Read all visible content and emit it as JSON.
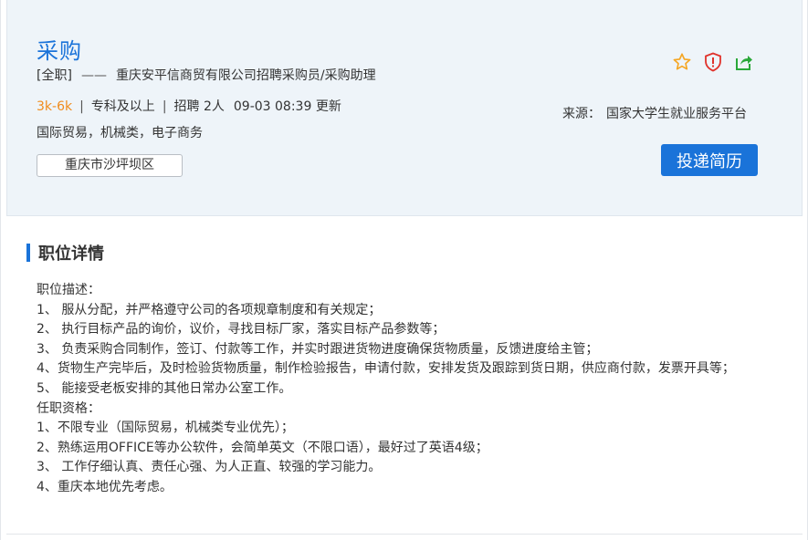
{
  "job": {
    "title": "采购",
    "type": "[全职]",
    "dash": "——",
    "company_line": "重庆安平信商贸有限公司招聘采购员/采购助理",
    "salary": "3k-6k",
    "sep": "|",
    "education": "专科及以上",
    "hiring": "招聘 2人",
    "updated": "09-03 08:39 更新",
    "tags": "国际贸易，机械类，电子商务",
    "location": "重庆市沙坪坝区",
    "source_label": "来源：",
    "source_value": "国家大学生就业服务平台",
    "apply_label": "投递简历",
    "icons": [
      "star-icon",
      "report-shield-icon",
      "share-icon"
    ]
  },
  "detail": {
    "heading": "职位详情",
    "lines": [
      "职位描述：",
      "1、 服从分配，并严格遵守公司的各项规章制度和有关规定；",
      "2、 执行目标产品的询价，议价，寻找目标厂家，落实目标产品参数等；",
      "3、 负责采购合同制作，签订、付款等工作，并实时跟进货物进度确保货物质量，反馈进度给主管；",
      "4、货物生产完毕后，及时检验货物质量，制作检验报告，申请付款，安排发货及跟踪到货日期，供应商付款，发票开具等；",
      "5、 能接受老板安排的其他日常办公室工作。",
      "任职资格：",
      "1、不限专业（国际贸易，机械类专业优先）；",
      "2、熟练运用OFFICE等办公软件，会简单英文（不限口语），最好过了英语4级；",
      "3、 工作仔细认真、责任心强、为人正直、较强的学习能力。",
      "4、重庆本地优先考虑。"
    ]
  },
  "colors": {
    "accent": "#1a73d9",
    "salary": "#f08c1d",
    "header_bg": "#eef4f9",
    "star": "#f5a623",
    "report": "#e0322b",
    "share": "#2aa83a"
  }
}
